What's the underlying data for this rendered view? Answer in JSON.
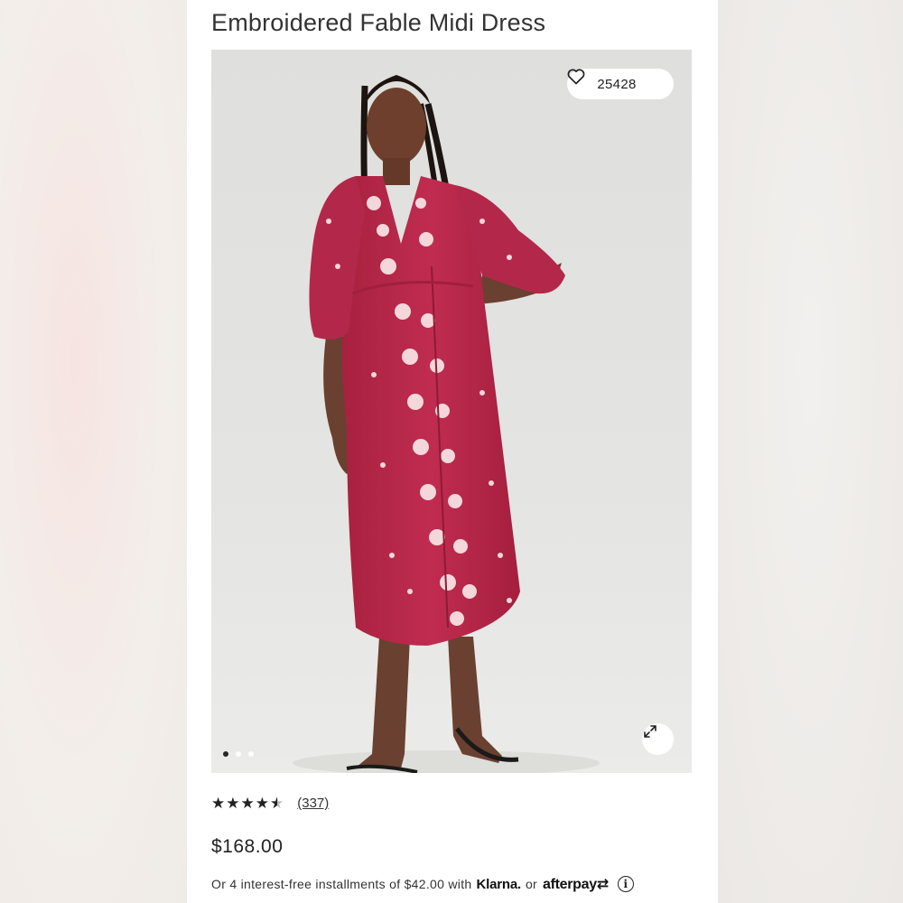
{
  "product": {
    "title": "Embroidered Fable Midi Dress",
    "favorite_count": "25428",
    "rating_value": 4.5,
    "rating_max": 5,
    "review_count": "(337)",
    "price": "$168.00"
  },
  "gallery": {
    "image_count": 3,
    "active_index": 0,
    "icons": {
      "favorite": "heart-icon",
      "expand": "expand-icon"
    }
  },
  "payment": {
    "installments_text": "Or 4 interest-free installments of $42.00 with",
    "klarna_label": "Klarna.",
    "or_text": "or",
    "afterpay_label": "afterpay",
    "info_icon": "info-icon"
  },
  "colors": {
    "dress": "#b8284a",
    "embroidery": "#f3d7da",
    "text": "#222222"
  }
}
